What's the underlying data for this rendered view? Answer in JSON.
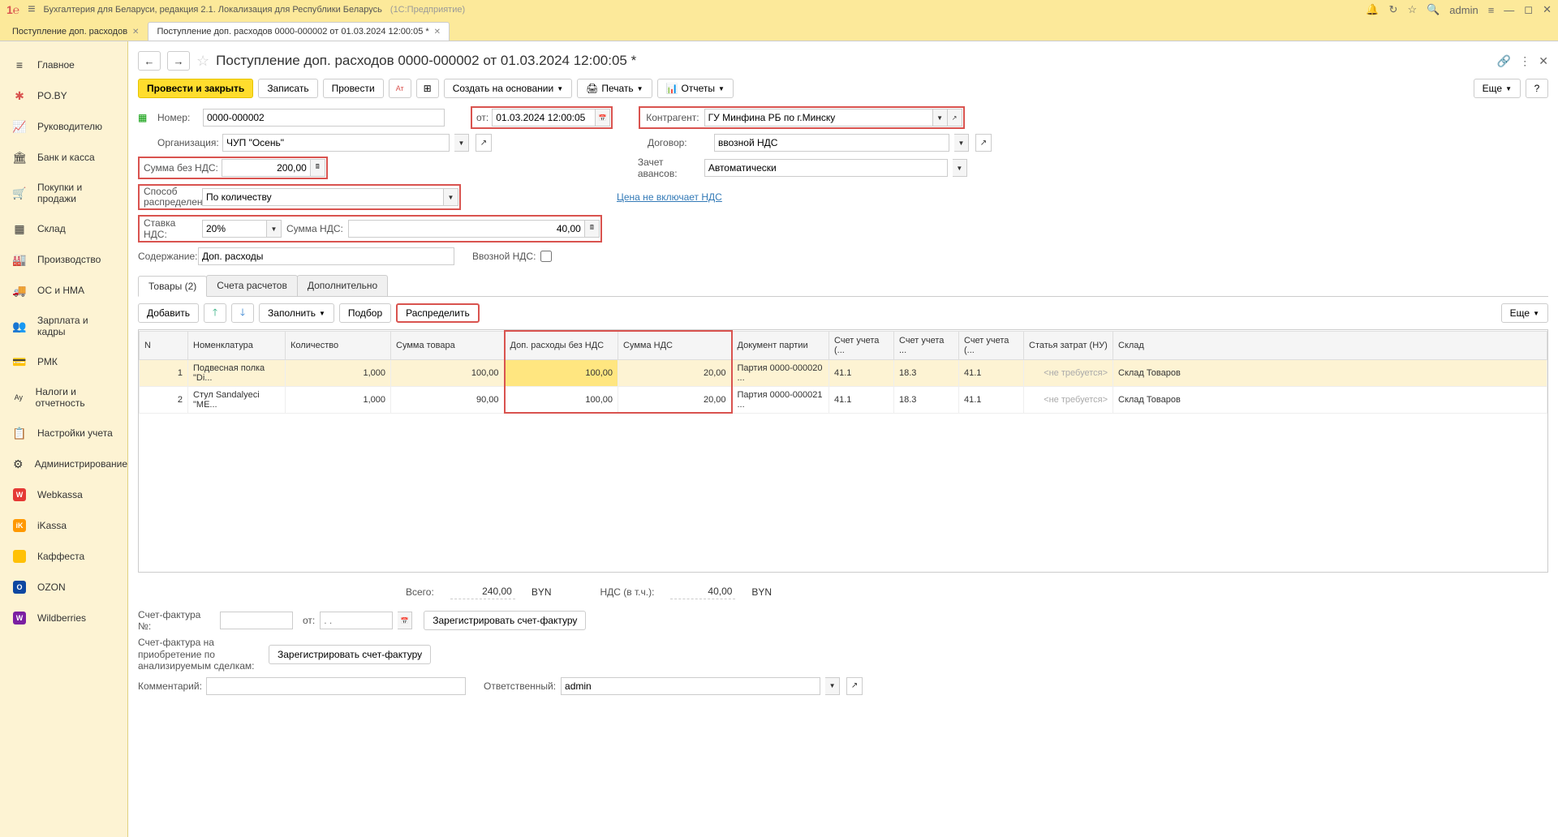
{
  "titlebar": {
    "app_title": "Бухгалтерия для Беларуси, редакция 2.1. Локализация для Республики Беларусь",
    "platform": "(1С:Предприятие)",
    "user": "admin"
  },
  "tabs": [
    {
      "label": "Поступление доп. расходов",
      "active": false
    },
    {
      "label": "Поступление доп. расходов 0000-000002 от 01.03.2024 12:00:05 *",
      "active": true
    }
  ],
  "sidebar": [
    {
      "label": "Главное",
      "icon": "≡"
    },
    {
      "label": "PO.BY",
      "icon": "✱"
    },
    {
      "label": "Руководителю",
      "icon": "📈"
    },
    {
      "label": "Банк и касса",
      "icon": "🏛"
    },
    {
      "label": "Покупки и продажи",
      "icon": "🛒"
    },
    {
      "label": "Склад",
      "icon": "▦"
    },
    {
      "label": "Производство",
      "icon": "🏭"
    },
    {
      "label": "ОС и НМА",
      "icon": "🚚"
    },
    {
      "label": "Зарплата и кадры",
      "icon": "👥"
    },
    {
      "label": "РМК",
      "icon": "💳"
    },
    {
      "label": "Налоги и отчетность",
      "icon": "Ау"
    },
    {
      "label": "Настройки учета",
      "icon": "📋"
    },
    {
      "label": "Администрирование",
      "icon": "⚙"
    },
    {
      "label": "Webkassa",
      "icon": "W",
      "bg": "#e53935"
    },
    {
      "label": "iKassa",
      "icon": "iK",
      "bg": "#ff9800"
    },
    {
      "label": "Каффеста",
      "icon": "●",
      "bg": "#ffc107"
    },
    {
      "label": "OZON",
      "icon": "O",
      "bg": "#0d47a1"
    },
    {
      "label": "Wildberries",
      "icon": "W",
      "bg": "#7b1fa2"
    }
  ],
  "doc": {
    "title": "Поступление доп. расходов 0000-000002 от 01.03.2024 12:00:05 *"
  },
  "toolbar": {
    "post_close": "Провести и закрыть",
    "save": "Записать",
    "post": "Провести",
    "create_based": "Создать на основании",
    "print": "Печать",
    "reports": "Отчеты",
    "more": "Еще"
  },
  "form": {
    "number_label": "Номер:",
    "number": "0000-000002",
    "date_label": "от:",
    "date": "01.03.2024 12:00:05",
    "org_label": "Организация:",
    "org": "ЧУП \"Осень\"",
    "counterparty_label": "Контрагент:",
    "counterparty": "ГУ Минфина РБ по г.Минску",
    "contract_label": "Договор:",
    "contract": "ввозной НДС",
    "advance_label": "Зачет авансов:",
    "advance": "Автоматически",
    "sum_novat_label": "Сумма без НДС:",
    "sum_novat": "200,00",
    "dist_label": "Способ распределения:",
    "dist": "По количеству",
    "vat_rate_label": "Ставка НДС:",
    "vat_rate": "20%",
    "vat_sum_label": "Сумма НДС:",
    "vat_sum": "40,00",
    "price_link": "Цена не включает НДС",
    "content_label": "Содержание:",
    "content": "Доп. расходы",
    "import_vat_label": "Ввозной НДС:"
  },
  "subtabs": [
    {
      "label": "Товары (2)",
      "active": true
    },
    {
      "label": "Счета расчетов",
      "active": false
    },
    {
      "label": "Дополнительно",
      "active": false
    }
  ],
  "subtoolbar": {
    "add": "Добавить",
    "fill": "Заполнить",
    "select": "Подбор",
    "distribute": "Распределить",
    "more": "Еще"
  },
  "table": {
    "headers": [
      "N",
      "Номенклатура",
      "Количество",
      "Сумма товара",
      "Доп. расходы без НДС",
      "Сумма НДС",
      "Документ партии",
      "Счет учета (...",
      "Счет учета ...",
      "Счет учета (...",
      "Статья затрат (НУ)",
      "Склад"
    ],
    "rows": [
      {
        "n": "1",
        "nom": "Подвесная полка \"Di...",
        "qty": "1,000",
        "sum": "100,00",
        "exp": "100,00",
        "vat": "20,00",
        "batch": "Партия 0000-000020 ...",
        "acc1": "41.1",
        "acc2": "18.3",
        "acc3": "41.1",
        "cost": "<не требуется>",
        "wh": "Склад Товаров"
      },
      {
        "n": "2",
        "nom": "Стул Sandalyeci \"ME...",
        "qty": "1,000",
        "sum": "90,00",
        "exp": "100,00",
        "vat": "20,00",
        "batch": "Партия 0000-000021 ...",
        "acc1": "41.1",
        "acc2": "18.3",
        "acc3": "41.1",
        "cost": "<не требуется>",
        "wh": "Склад Товаров"
      }
    ]
  },
  "totals": {
    "total_label": "Всего:",
    "total": "240,00",
    "currency": "BYN",
    "vat_label": "НДС (в т.ч.):",
    "vat": "40,00"
  },
  "footer": {
    "invoice_num_label": "Счет-фактура №:",
    "invoice_from": "от:",
    "invoice_date_placeholder": ". .",
    "reg_invoice": "Зарегистрировать счет-фактуру",
    "invoice_deals_label": "Счет-фактура на приобретение по анализируемым сделкам:",
    "reg_invoice2": "Зарегистрировать счет-фактуру",
    "comment_label": "Комментарий:",
    "responsible_label": "Ответственный:",
    "responsible": "admin"
  }
}
